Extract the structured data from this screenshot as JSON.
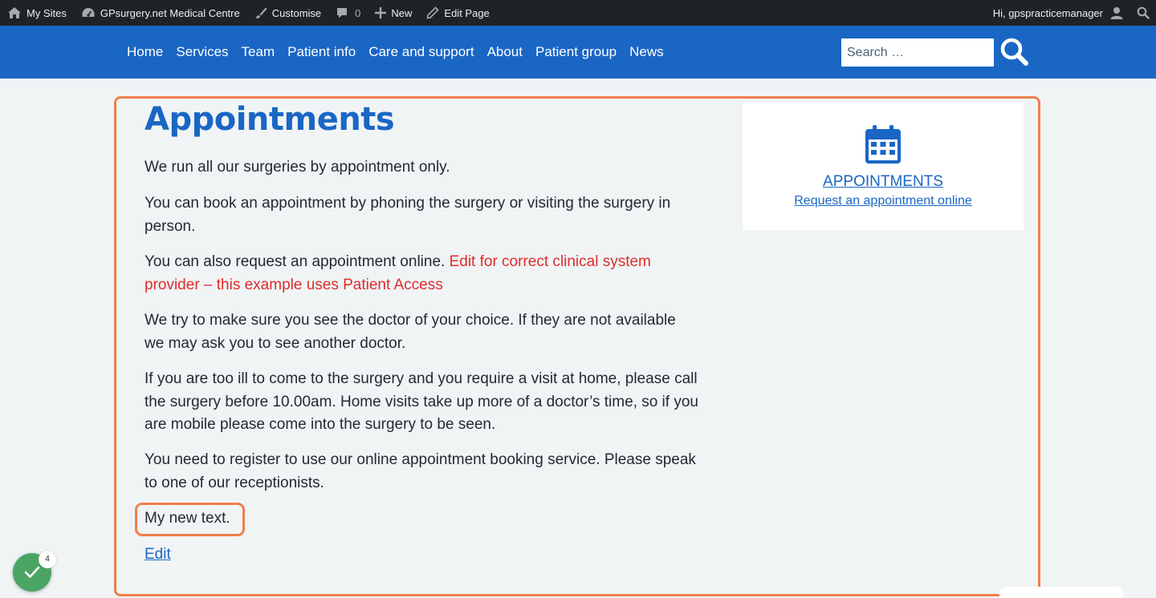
{
  "admin_bar": {
    "my_sites": "My Sites",
    "site_name": "GPsurgery.net Medical Centre",
    "customise": "Customise",
    "comments_count": "0",
    "new": "New",
    "edit_page": "Edit Page",
    "greeting": "Hi, gpspracticemanager"
  },
  "nav": {
    "items": [
      "Home",
      "Services",
      "Team",
      "Patient info",
      "Care and support",
      "About",
      "Patient group",
      "News"
    ]
  },
  "search": {
    "placeholder": "Search …"
  },
  "page": {
    "title": "Appointments",
    "p1": "We run all our surgeries by appointment only.",
    "p2": "You can book an appointment by phoning the surgery or visiting the surgery in person.",
    "p3_intro": "You can also request an appointment online. ",
    "p3_note": "Edit for correct clinical system provider – this example uses Patient Access",
    "p4": "We try to make sure you see the doctor of your choice. If they are not available we may ask you to see another doctor.",
    "p5": "If you are too ill to come to the surgery and you require a visit at home, please call the surgery before 10.00am. Home visits take up more of a doctor’s time, so if you are mobile please come into the surgery to be seen.",
    "p6": "You need to register to use our online appointment booking service. Please speak to one of our receptionists.",
    "new_text": "My new text.",
    "edit_link": "Edit"
  },
  "sidebar_card": {
    "icon": "calendar-icon",
    "title": "APPOINTMENTS",
    "link": "Request an appointment online"
  },
  "widget": {
    "count": "4"
  },
  "colors": {
    "brand_blue": "#1a66c5",
    "admin_bar": "#1d2327",
    "highlight_orange": "#f07f4b",
    "note_red": "#e22b2b",
    "widget_green": "#4aa564"
  }
}
